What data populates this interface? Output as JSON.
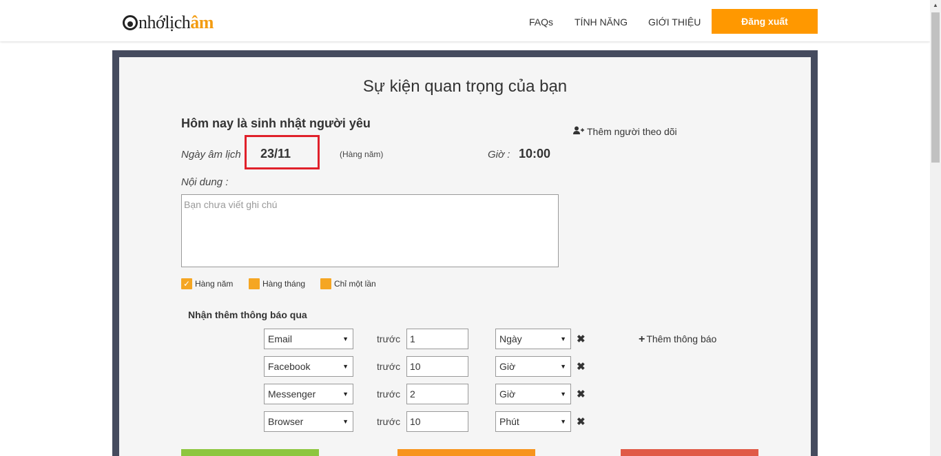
{
  "header": {
    "logo_text_prefix": "nhớlịch",
    "logo_text_accent": "âm",
    "nav": [
      "FAQs",
      "TÍNH NĂNG",
      "GIỚI THIỆU"
    ],
    "logout_label": "Đăng xuất"
  },
  "page": {
    "title": "Sự kiện quan trọng của bạn",
    "event_name": "Hôm nay là sinh nhật người yêu",
    "add_follower_label": "Thêm người theo dõi",
    "lunar_date_label": "Ngày âm lịch",
    "lunar_date_value": "23/11",
    "repeat_note": "(Hàng năm)",
    "time_label": "Giờ :",
    "time_value": "10:00",
    "content_label": "Nội dung :",
    "note_placeholder": "Bạn chưa viết ghi chú",
    "note_value": ""
  },
  "repeat_options": [
    {
      "label": "Hàng năm",
      "checked": true
    },
    {
      "label": "Hàng tháng",
      "checked": false
    },
    {
      "label": "Chỉ một lần",
      "checked": false
    }
  ],
  "notifications": {
    "title": "Nhận thêm thông báo qua",
    "before_label": "trước",
    "add_label": "Thêm thông báo",
    "rows": [
      {
        "channel": "Email",
        "amount": "1",
        "unit": "Ngày"
      },
      {
        "channel": "Facebook",
        "amount": "10",
        "unit": "Giờ"
      },
      {
        "channel": "Messenger",
        "amount": "2",
        "unit": "Giờ"
      },
      {
        "channel": "Browser",
        "amount": "10",
        "unit": "Phút"
      }
    ]
  },
  "colors": {
    "accent": "#ff9800",
    "frame": "#454b5e",
    "highlight": "#e0202a",
    "btn_green": "#8dc63f",
    "btn_orange": "#f7941d",
    "btn_red": "#e05a47"
  }
}
